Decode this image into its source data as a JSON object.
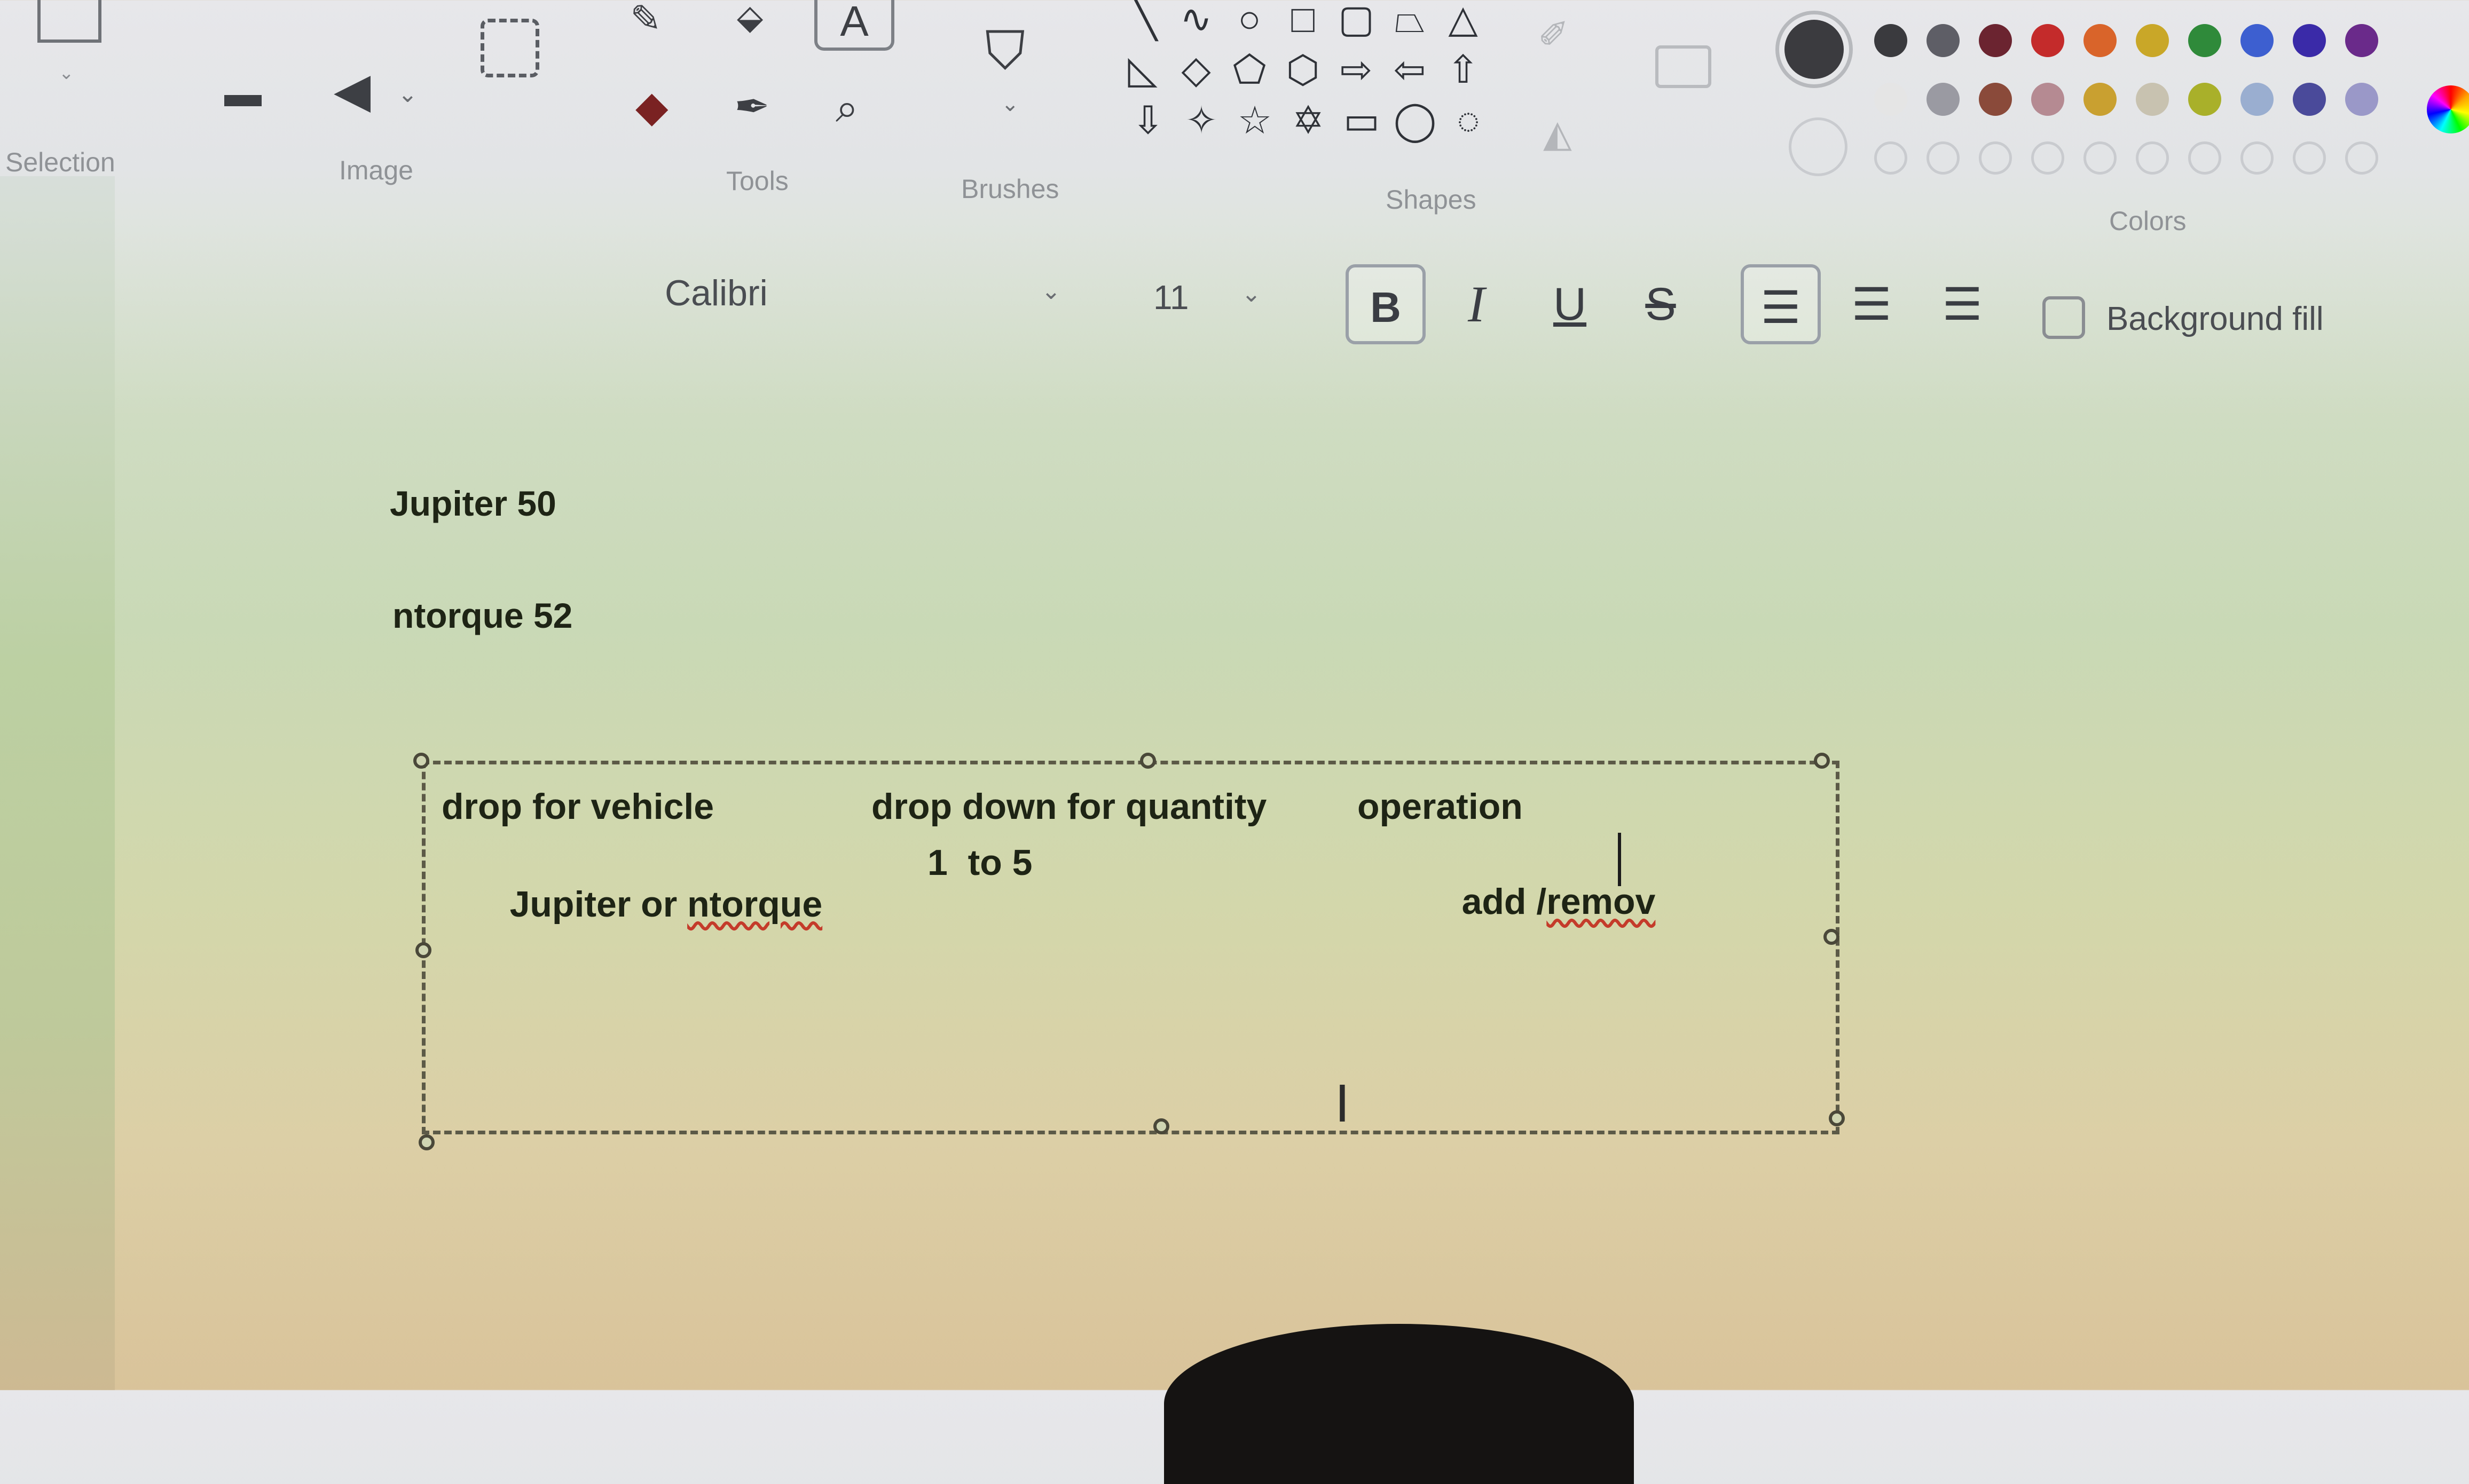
{
  "ribbon": {
    "groups": {
      "selection": "Selection",
      "image": "Image",
      "tools": "Tools",
      "brushes": "Brushes",
      "shapes": "Shapes",
      "colors": "Colors"
    },
    "text_tool_glyph": "A",
    "colors": {
      "row1": [
        "#3a3a3e",
        "#5e5e66",
        "#6b2430",
        "#c42b2b",
        "#d9642a",
        "#c9a728",
        "#2f8a3a",
        "#3d5fd0",
        "#3a2aa8",
        "#6a2a8a"
      ],
      "row2": [
        "#e5e5e5",
        "#9a9aa2",
        "#8a4a3a",
        "#b58a92",
        "#c9a030",
        "#c8c2b0",
        "#a9b02a",
        "#9aaed0",
        "#4a4a9a",
        "#9a98c8"
      ],
      "primary": "#3b3b3f"
    }
  },
  "format": {
    "font_name": "Calibri",
    "font_size": "11",
    "bold": "B",
    "italic": "I",
    "underline": "U",
    "strike": "S",
    "background_fill": "Background fill"
  },
  "canvas": {
    "line1": "Jupiter 50",
    "line2": "ntorque 52",
    "textbox": {
      "h1": "drop for vehicle",
      "h2": "drop down for quantity",
      "h3": "operation",
      "v1_prefix": "Jupiter or ",
      "v1_misspelled": "ntorque",
      "v2": "1  to 5",
      "v3_prefix": "add /",
      "v3_misspelled": "remov"
    }
  }
}
